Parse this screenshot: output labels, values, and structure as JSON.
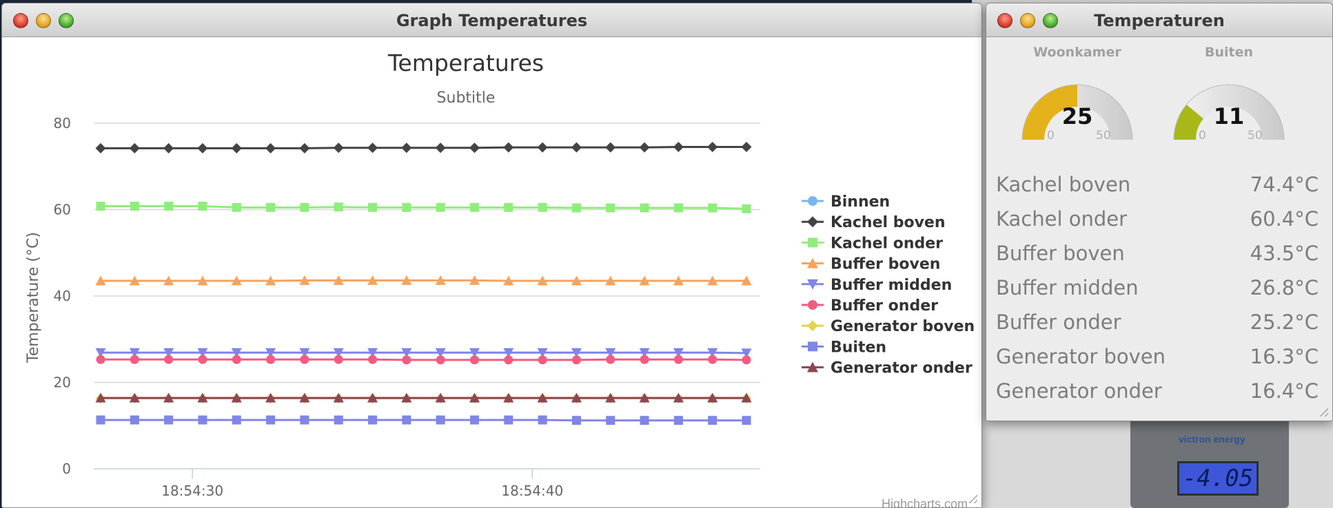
{
  "graph_window": {
    "title": "Graph Temperatures"
  },
  "temps_window": {
    "title": "Temperaturen"
  },
  "chart_data": {
    "type": "line",
    "title": "Temperatures",
    "subtitle": "Subtitle",
    "ylabel": "Temperature (°C)",
    "xlabel": "",
    "ylim": [
      0,
      80
    ],
    "yticks": [
      0,
      20,
      40,
      60,
      80
    ],
    "xticks": [
      "18:54:30",
      "18:54:40"
    ],
    "xtick_index": [
      2.7,
      12.7
    ],
    "num_points": 20,
    "legend_position": "right",
    "credits": "Highcharts.com",
    "series": [
      {
        "name": "Binnen",
        "color": "#7cb5ec",
        "marker": "circle",
        "values": []
      },
      {
        "name": "Kachel boven",
        "color": "#434348",
        "marker": "diamond",
        "values": [
          74.2,
          74.2,
          74.2,
          74.2,
          74.2,
          74.2,
          74.2,
          74.3,
          74.3,
          74.3,
          74.3,
          74.3,
          74.4,
          74.4,
          74.4,
          74.4,
          74.4,
          74.5,
          74.5,
          74.5
        ]
      },
      {
        "name": "Kachel onder",
        "color": "#90ed7d",
        "marker": "square",
        "values": [
          60.8,
          60.8,
          60.8,
          60.8,
          60.5,
          60.5,
          60.5,
          60.6,
          60.5,
          60.5,
          60.5,
          60.5,
          60.5,
          60.5,
          60.4,
          60.4,
          60.4,
          60.4,
          60.4,
          60.2
        ]
      },
      {
        "name": "Buffer boven",
        "color": "#f7a35c",
        "marker": "triangle",
        "values": [
          43.5,
          43.5,
          43.5,
          43.5,
          43.5,
          43.5,
          43.6,
          43.6,
          43.6,
          43.6,
          43.6,
          43.6,
          43.5,
          43.5,
          43.5,
          43.5,
          43.5,
          43.5,
          43.5,
          43.5
        ]
      },
      {
        "name": "Buffer midden",
        "color": "#8085e9",
        "marker": "triangle-down",
        "values": [
          26.9,
          26.9,
          26.9,
          26.9,
          26.9,
          26.9,
          26.9,
          26.9,
          26.9,
          26.9,
          26.9,
          26.9,
          26.9,
          26.9,
          26.9,
          26.9,
          26.9,
          26.9,
          26.9,
          26.8
        ]
      },
      {
        "name": "Buffer onder",
        "color": "#f15c80",
        "marker": "circle",
        "values": [
          25.3,
          25.3,
          25.3,
          25.3,
          25.3,
          25.3,
          25.3,
          25.3,
          25.3,
          25.2,
          25.2,
          25.2,
          25.2,
          25.2,
          25.2,
          25.3,
          25.3,
          25.3,
          25.3,
          25.2
        ]
      },
      {
        "name": "Generator boven",
        "color": "#e4d354",
        "marker": "diamond",
        "values": [
          16.3,
          16.3,
          16.3,
          16.3,
          16.3,
          16.3,
          16.3,
          16.3,
          16.3,
          16.3,
          16.3,
          16.3,
          16.3,
          16.3,
          16.3,
          16.3,
          16.3,
          16.3,
          16.3,
          16.3
        ]
      },
      {
        "name": "Buiten",
        "color": "#8085e8",
        "marker": "square",
        "values": [
          11.3,
          11.3,
          11.3,
          11.3,
          11.3,
          11.3,
          11.3,
          11.3,
          11.3,
          11.3,
          11.3,
          11.3,
          11.3,
          11.3,
          11.2,
          11.2,
          11.2,
          11.2,
          11.2,
          11.2
        ]
      },
      {
        "name": "Generator onder",
        "color": "#8d4653",
        "marker": "triangle",
        "values": [
          16.4,
          16.4,
          16.4,
          16.4,
          16.4,
          16.4,
          16.4,
          16.4,
          16.4,
          16.4,
          16.4,
          16.4,
          16.4,
          16.4,
          16.4,
          16.4,
          16.4,
          16.4,
          16.4,
          16.4
        ]
      }
    ]
  },
  "gauges": [
    {
      "title": "Woonkamer",
      "value": 25,
      "min": 0,
      "max": 50,
      "color": "#e3b21a"
    },
    {
      "title": "Buiten",
      "value": 11,
      "min": 0,
      "max": 50,
      "color": "#a8b818"
    }
  ],
  "temperatures": [
    {
      "label": "Kachel boven",
      "value": "74.4°C"
    },
    {
      "label": "Kachel onder",
      "value": "60.4°C"
    },
    {
      "label": "Buffer boven",
      "value": "43.5°C"
    },
    {
      "label": "Buffer midden",
      "value": "26.8°C"
    },
    {
      "label": "Buffer onder",
      "value": "25.2°C"
    },
    {
      "label": "Generator boven",
      "value": "16.3°C"
    },
    {
      "label": "Generator onder",
      "value": "16.4°C"
    }
  ],
  "desktop": {
    "device_display": "-4.05",
    "device_brand": "victron energy"
  }
}
